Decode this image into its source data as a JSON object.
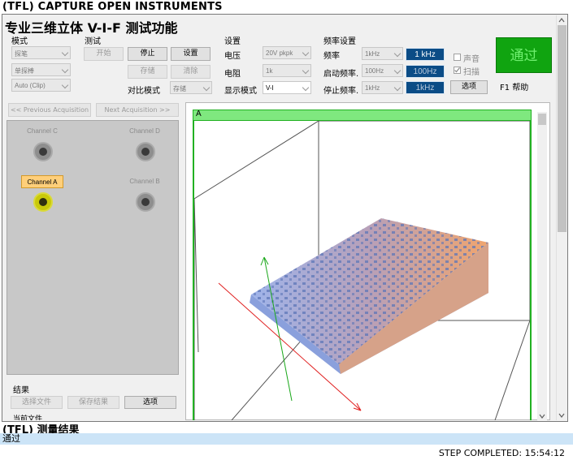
{
  "app_title": "(TFL) CAPTURE OPEN INSTRUMENTS",
  "panel_title": "专业三维立体 V-I-F 测试功能",
  "mode": {
    "label": "模式",
    "probe_select": "探笔",
    "single_probe_select": "单探棒",
    "auto_clip_select": "Auto (Clip)"
  },
  "test": {
    "label": "测试",
    "start_button": "开始",
    "stop_button": "停止",
    "setup_button": "设置",
    "save_button": "存储",
    "clear_button": "清除",
    "compare_mode_label": "对比模式",
    "compare_mode_select": "存储"
  },
  "settings": {
    "label": "设置",
    "voltage_label": "电压",
    "voltage_select": "20V pkpk",
    "resistance_label": "电阻",
    "resistance_select": "1k",
    "display_mode_label": "显示模式",
    "display_mode_select": "V-I"
  },
  "frequency": {
    "label": "频率设置",
    "freq_label": "频率",
    "freq_select": "1kHz",
    "freq_value": "1 kHz",
    "start_freq_label": "启动频率.",
    "start_freq_select": "100Hz",
    "start_freq_value": "100Hz",
    "stop_freq_label": "停止频率.",
    "stop_freq_select": "1kHz",
    "stop_freq_value": "1kHz",
    "sound_label": "声音",
    "sound_checked": false,
    "sweep_label": "扫描",
    "sweep_checked": true,
    "options_button": "选项"
  },
  "status_pass": "通过",
  "help_label": "F1 帮助",
  "acquisition": {
    "previous": "<< Previous Acquisition",
    "next": "Next Acquisition >>"
  },
  "channels": {
    "c": "Channel C",
    "d": "Channel D",
    "a": "Channel A",
    "b": "Channel B"
  },
  "results_section": {
    "label": "结果",
    "select_file_button": "选择文件",
    "save_result_button": "保存结果",
    "options_button": "选项",
    "current_file_label": "当前文件"
  },
  "plot": {
    "tab_label": "A"
  },
  "measurement_title": "(TFL) 测量结果",
  "measurement_result": "通过",
  "step_status": "STEP COMPLETED: 15:54:12",
  "colors": {
    "pass_green": "#10a410",
    "value_blue": "#0b4c86",
    "selected_row": "#cce4f7",
    "channel_a_highlight": "#ffcf7a"
  }
}
